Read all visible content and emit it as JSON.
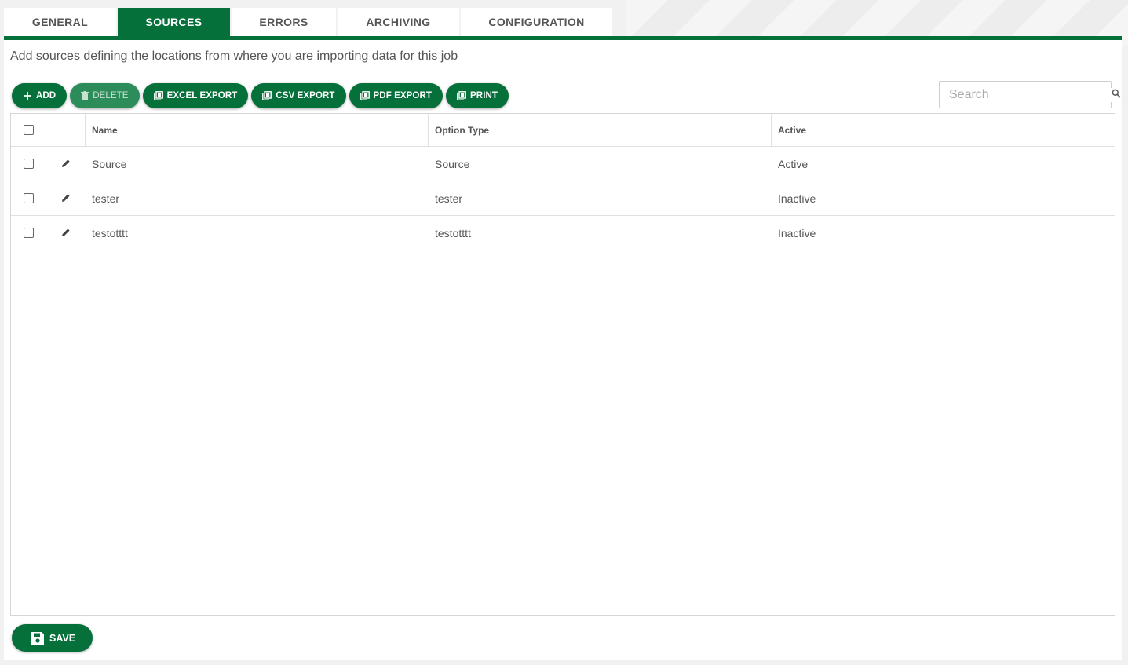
{
  "tabs": [
    {
      "label": "GENERAL",
      "active": false
    },
    {
      "label": "SOURCES",
      "active": true
    },
    {
      "label": "ERRORS",
      "active": false
    },
    {
      "label": "ARCHIVING",
      "active": false
    },
    {
      "label": "CONFIGURATION",
      "active": false
    }
  ],
  "description": "Add sources defining the locations from where you are importing data for this job",
  "toolbar": {
    "add": "ADD",
    "delete": "DELETE",
    "excel_export": "EXCEL EXPORT",
    "csv_export": "CSV EXPORT",
    "pdf_export": "PDF EXPORT",
    "print": "PRINT",
    "delete_disabled": true
  },
  "search": {
    "placeholder": "Search",
    "value": ""
  },
  "grid": {
    "columns": [
      "Name",
      "Option Type",
      "Active"
    ],
    "rows": [
      {
        "name": "Source",
        "option_type": "Source",
        "active": "Active",
        "checked": false
      },
      {
        "name": "tester",
        "option_type": "tester",
        "active": "Inactive",
        "checked": false
      },
      {
        "name": "testotttt",
        "option_type": "testotttt",
        "active": "Inactive",
        "checked": false
      }
    ]
  },
  "save_label": "SAVE",
  "icons": {
    "add": "plus-icon",
    "delete": "trash-icon",
    "export": "export-icon",
    "search": "search-icon",
    "edit": "pencil-icon",
    "save": "floppy-disk-icon"
  },
  "colors": {
    "primary": "#06703a",
    "primary_disabled": "#2d8d5a"
  }
}
